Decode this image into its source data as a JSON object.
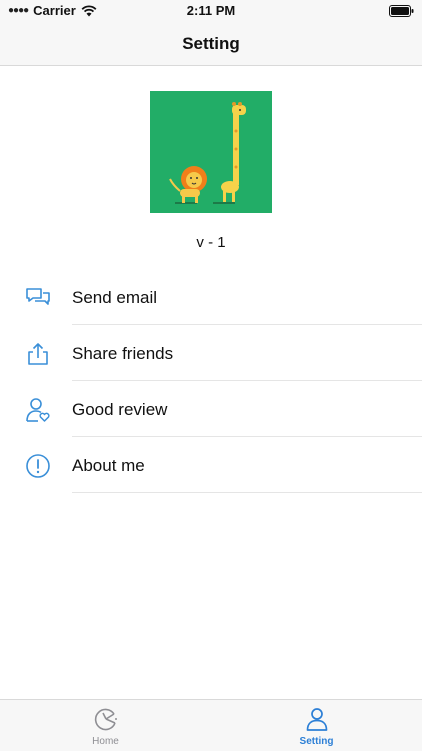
{
  "status": {
    "carrier": "Carrier",
    "time": "2:11 PM"
  },
  "nav": {
    "title": "Setting"
  },
  "app": {
    "version": "v - 1"
  },
  "menu": [
    {
      "label": "Send email",
      "icon": "chat-bubbles-icon"
    },
    {
      "label": "Share friends",
      "icon": "share-icon"
    },
    {
      "label": "Good review",
      "icon": "user-heart-icon"
    },
    {
      "label": "About me",
      "icon": "info-icon"
    }
  ],
  "tabs": [
    {
      "label": "Home",
      "icon": "pie-clock-icon",
      "active": false
    },
    {
      "label": "Setting",
      "icon": "person-icon",
      "active": true
    }
  ],
  "colors": {
    "accent": "#2c7fd6",
    "icon": "#3a8fd8",
    "logo_bg": "#22ad67"
  }
}
